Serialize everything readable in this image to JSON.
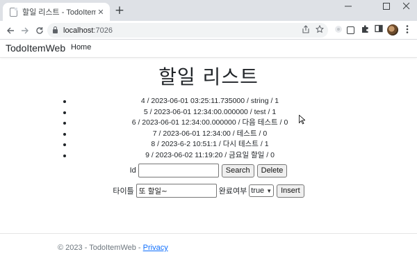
{
  "browser": {
    "tab_title": "할일 리스트 - TodoItemWeb",
    "tab_close": "✕",
    "new_tab": "+",
    "url_host": "localhost",
    "url_port": ":7026",
    "win_min": "—",
    "win_max": "☐",
    "win_close": "✕"
  },
  "navbar": {
    "brand": "TodoItemWeb",
    "home": "Home"
  },
  "heading": "할일 리스트",
  "todos": [
    "4 / 2023-06-01 03:25:11.735000 / string / 1",
    "5 / 2023-06-01 12:34:00.000000 / test / 1",
    "6 / 2023-06-01 12:34:00.000000 / 다음 테스트 / 0",
    "7 / 2023-06-01 12:34:00 / 테스트 / 0",
    "8 / 2023-6-2 10:51:1 / 다시 테스트 / 1",
    "9 / 2023-06-02 11:19:20 / 금요일 할일 / 0"
  ],
  "id_form": {
    "label": "Id",
    "value": "",
    "search_label": "Search",
    "delete_label": "Delete"
  },
  "insert_form": {
    "title_label": "타이틀",
    "title_value": "또 할일~",
    "done_label": "완료여부",
    "done_selected": "true",
    "insert_label": "Insert"
  },
  "footer": {
    "copyright": "© 2023 - TodoItemWeb - ",
    "privacy": "Privacy"
  }
}
